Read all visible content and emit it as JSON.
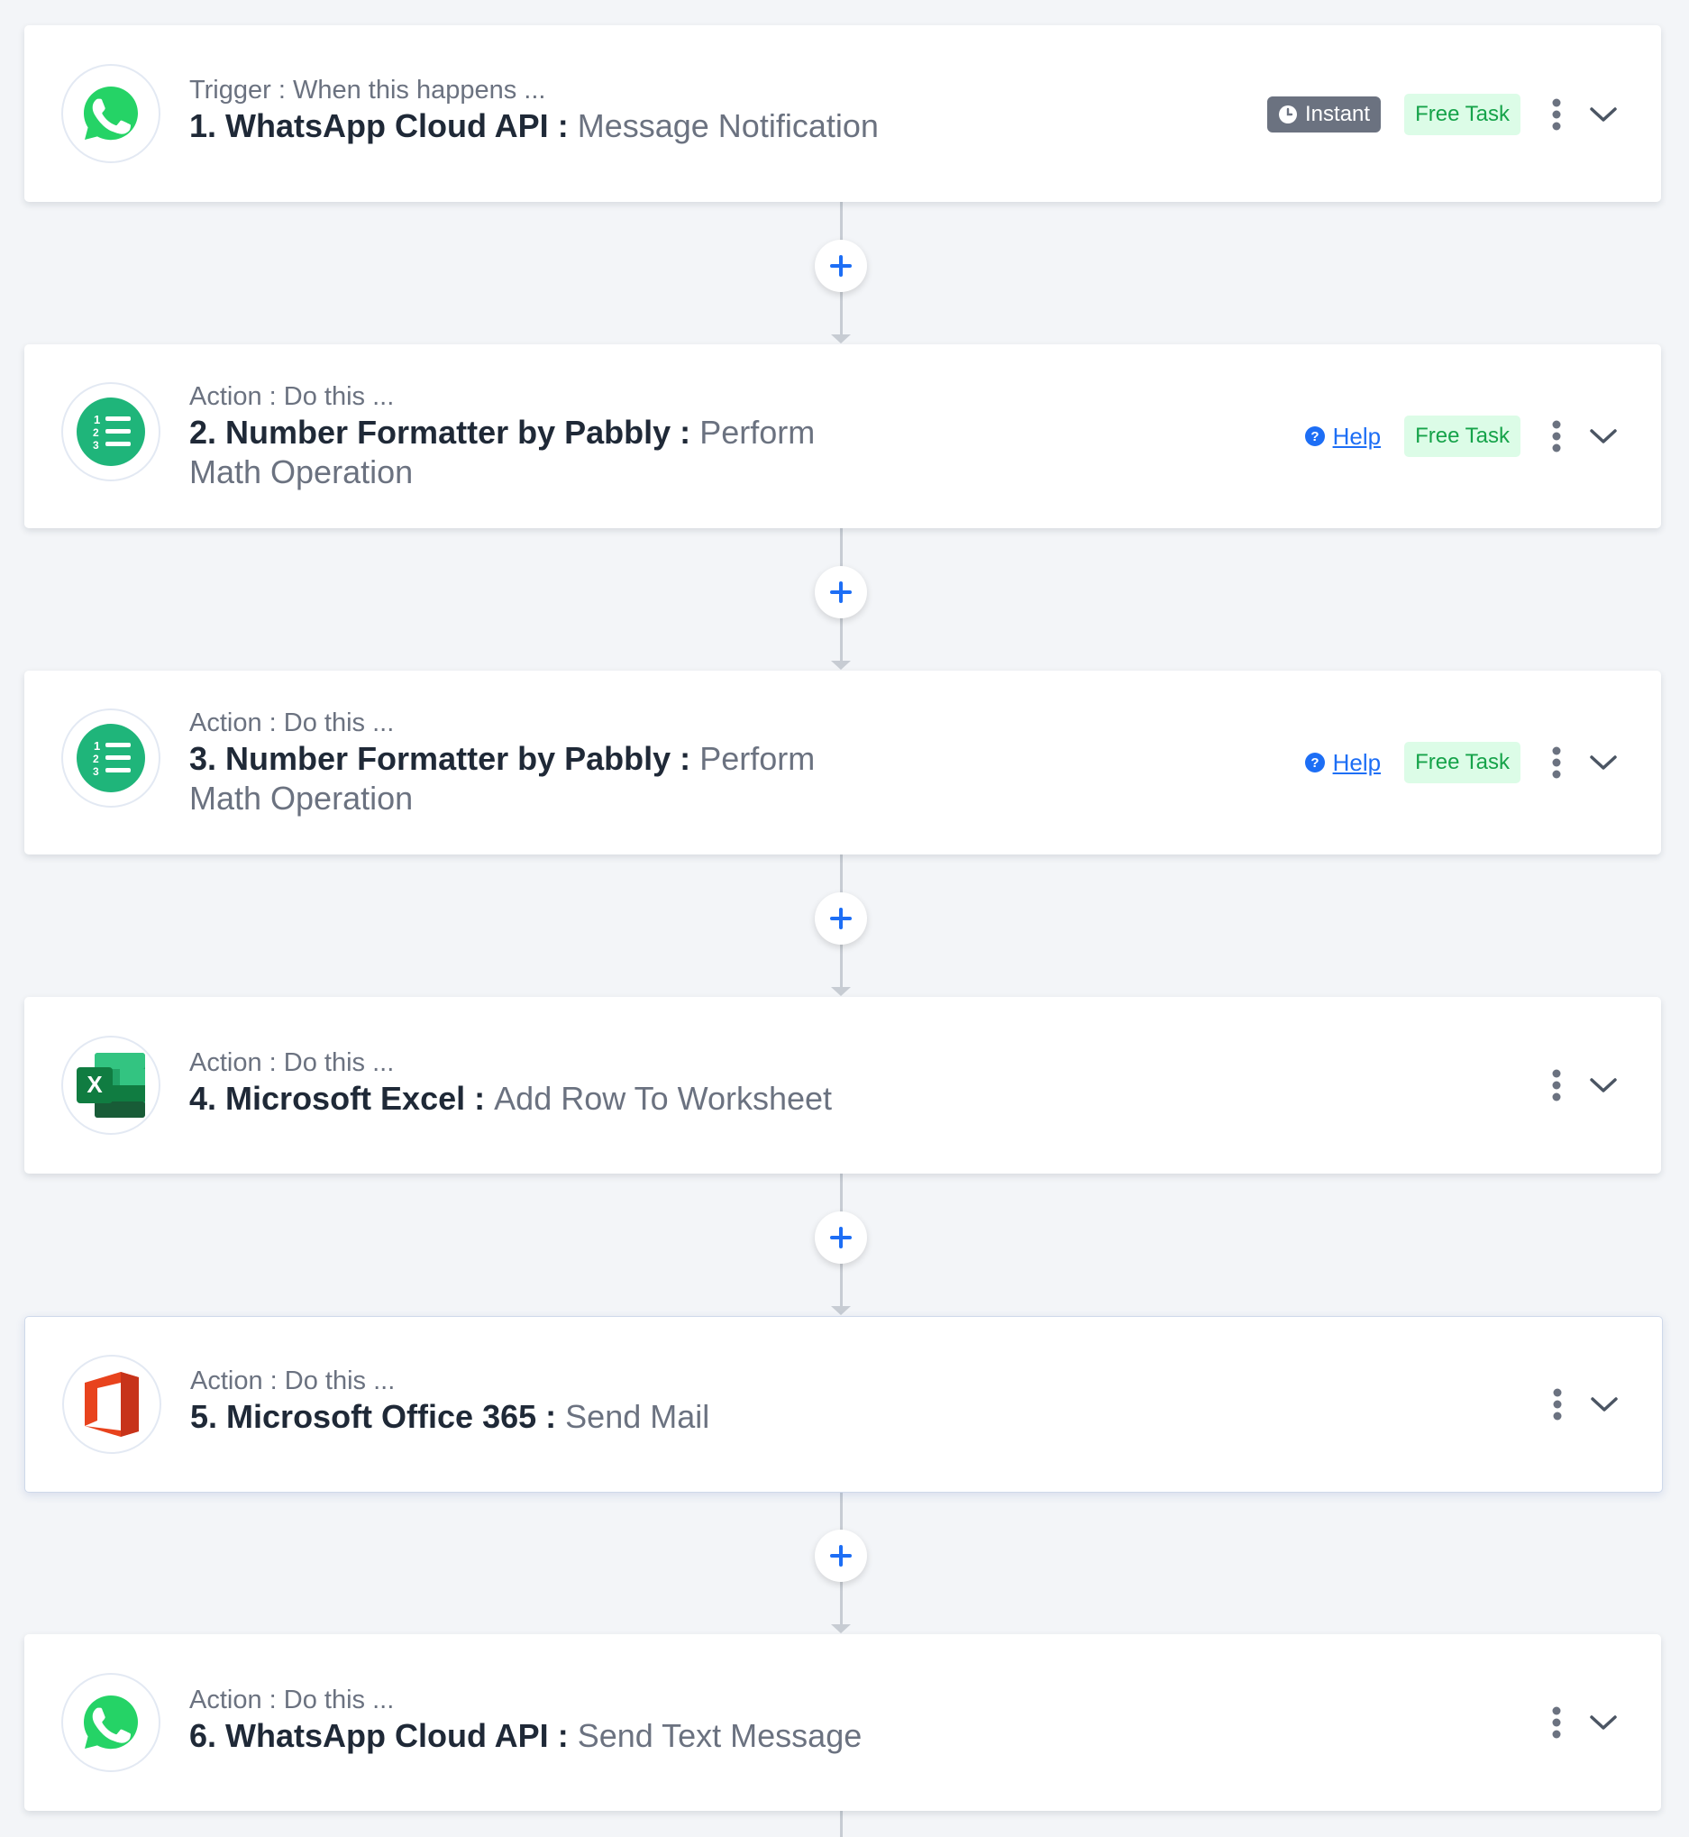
{
  "steps": [
    {
      "kind": "Trigger : When this happens ...",
      "number": "1.",
      "app": "WhatsApp Cloud API",
      "separator": ":",
      "event": "Message Notification",
      "logo": "whatsapp-logo",
      "instant_label": "Instant",
      "free_label": "Free Task"
    },
    {
      "kind": "Action : Do this ...",
      "number": "2.",
      "app": "Number Formatter by Pabbly",
      "separator": ":",
      "event": "Perform Math Operation",
      "logo": "number-formatter-logo",
      "help_label": "Help",
      "free_label": "Free Task"
    },
    {
      "kind": "Action : Do this ...",
      "number": "3.",
      "app": "Number Formatter by Pabbly",
      "separator": ":",
      "event": "Perform Math Operation",
      "logo": "number-formatter-logo",
      "help_label": "Help",
      "free_label": "Free Task"
    },
    {
      "kind": "Action : Do this ...",
      "number": "4.",
      "app": "Microsoft Excel",
      "separator": ":",
      "event": "Add Row To Worksheet",
      "logo": "excel-logo"
    },
    {
      "kind": "Action : Do this ...",
      "number": "5.",
      "app": "Microsoft Office 365",
      "separator": ":",
      "event": "Send Mail",
      "logo": "office365-logo"
    },
    {
      "kind": "Action : Do this ...",
      "number": "6.",
      "app": "WhatsApp Cloud API",
      "separator": ":",
      "event": "Send Text Message",
      "logo": "whatsapp-logo"
    }
  ],
  "colors": {
    "accent_blue": "#1d6ef5",
    "whatsapp_green": "#25d366",
    "formatter_green": "#1fb57a",
    "free_task_bg": "#dcfce7",
    "free_task_text": "#16a34a",
    "instant_bg": "#6b7280"
  }
}
